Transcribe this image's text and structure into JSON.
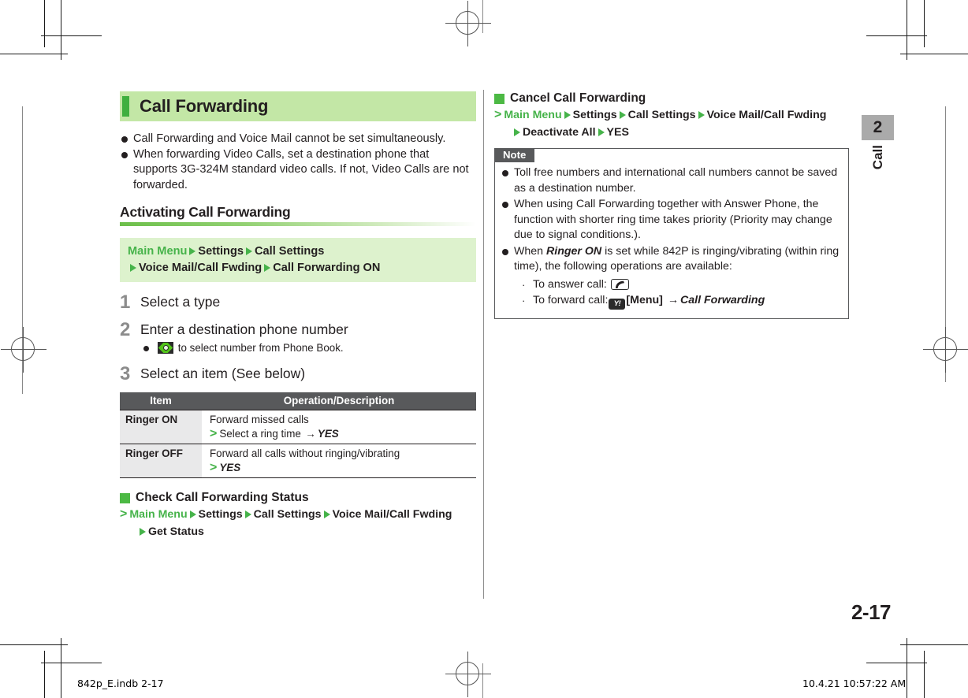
{
  "document": {
    "title": "Call Forwarding",
    "page_number": "2-17",
    "chapter_number": "2",
    "chapter_label": "Call"
  },
  "footer": {
    "file": "842p_E.indb   2-17",
    "timestamp": "10.4.21   10:57:22 AM"
  },
  "left": {
    "intro_bullets": [
      "Call Forwarding and Voice Mail cannot be set simultaneously.",
      "When forwarding Video Calls, set a destination phone that supports 3G-324M standard video calls. If not, Video Calls are not forwarded."
    ],
    "section_heading": "Activating Call Forwarding",
    "nav_path": {
      "root": "Main Menu",
      "step2": "Settings",
      "step3": "Call Settings",
      "step4": "Voice Mail/Call Fwding",
      "step5": "Call Forwarding ON"
    },
    "steps": [
      {
        "num": "1",
        "title": "Select a type",
        "sub": ""
      },
      {
        "num": "2",
        "title": "Enter a destination phone number",
        "sub": "to select number from Phone Book."
      },
      {
        "num": "3",
        "title": "Select an item (See below)",
        "sub": ""
      }
    ],
    "table": {
      "headers": [
        "Item",
        "Operation/Description"
      ],
      "rows": [
        {
          "item": "Ringer ON",
          "desc_line1": "Forward missed calls",
          "desc_line2_pre": "Select a ring time",
          "desc_line2_arrow": "→",
          "desc_line2_post": "YES"
        },
        {
          "item": "Ringer OFF",
          "desc_line1": "Forward all calls without ringing/vibrating",
          "desc_line2_pre": "",
          "desc_line2_arrow": "",
          "desc_line2_post": "YES"
        }
      ]
    },
    "check_status": {
      "heading": "Check Call Forwarding Status",
      "path": [
        "Main Menu",
        "Settings",
        "Call Settings",
        "Voice Mail/Call Fwding",
        "Get Status"
      ]
    }
  },
  "right": {
    "cancel": {
      "heading": "Cancel Call Forwarding",
      "path": [
        "Main Menu",
        "Settings",
        "Call Settings",
        "Voice Mail/Call Fwding",
        "Deactivate All",
        "YES"
      ]
    },
    "note": {
      "label": "Note",
      "items": [
        {
          "text": "Toll free numbers and international call numbers cannot be saved as a destination number."
        },
        {
          "text": "When using Call Forwarding together with Answer Phone, the function with shorter ring time takes priority (Priority may change due to signal conditions.)."
        },
        {
          "prefix": "When ",
          "emphasis": "Ringer ON",
          "suffix": " is set while 842P is ringing/vibrating (within ring time), the following operations are available:",
          "subitems": [
            {
              "label": "To answer call:",
              "key": "call-key",
              "after": ""
            },
            {
              "label": "To forward call:",
              "key": "menu-key",
              "bracket": "[Menu]",
              "arrow": "→",
              "after": "Call Forwarding"
            }
          ]
        }
      ]
    }
  }
}
